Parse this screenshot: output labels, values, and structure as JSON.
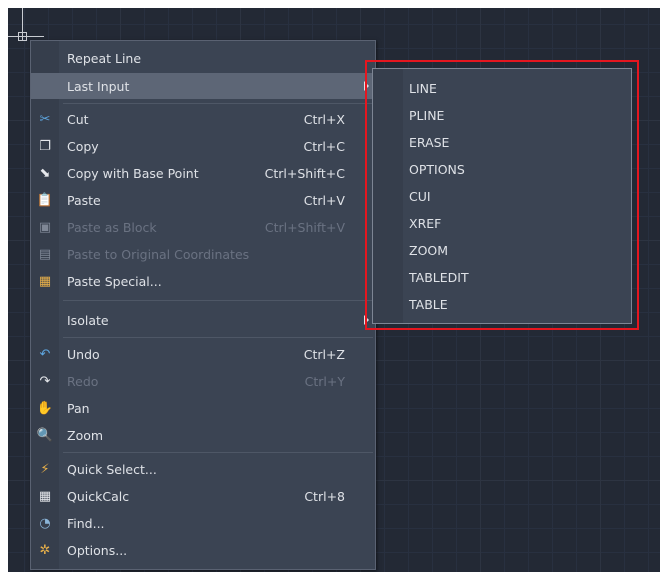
{
  "context_menu": {
    "items": [
      {
        "label": "Repeat Line",
        "shortcut": "",
        "icon": "",
        "disabled": false
      },
      {
        "label": "Last Input",
        "shortcut": "",
        "icon": "",
        "disabled": false,
        "submenu": true,
        "highlighted": true
      },
      {
        "label": "Cut",
        "shortcut": "Ctrl+X",
        "icon": "scissors-icon",
        "disabled": false
      },
      {
        "label": "Copy",
        "shortcut": "Ctrl+C",
        "icon": "copy-icon",
        "disabled": false
      },
      {
        "label": "Copy with Base Point",
        "shortcut": "Ctrl+Shift+C",
        "icon": "copy-base-point-icon",
        "disabled": false
      },
      {
        "label": "Paste",
        "shortcut": "Ctrl+V",
        "icon": "paste-icon",
        "disabled": false
      },
      {
        "label": "Paste as Block",
        "shortcut": "Ctrl+Shift+V",
        "icon": "paste-block-icon",
        "disabled": true
      },
      {
        "label": "Paste to Original Coordinates",
        "shortcut": "",
        "icon": "paste-original-icon",
        "disabled": true
      },
      {
        "label": "Paste Special...",
        "shortcut": "",
        "icon": "paste-special-icon",
        "disabled": false
      },
      {
        "label": "Isolate",
        "shortcut": "",
        "icon": "",
        "disabled": false,
        "submenu": true
      },
      {
        "label": "Undo",
        "shortcut": "Ctrl+Z",
        "icon": "undo-icon",
        "disabled": false
      },
      {
        "label": "Redo",
        "shortcut": "Ctrl+Y",
        "icon": "redo-icon",
        "disabled": true
      },
      {
        "label": "Pan",
        "shortcut": "",
        "icon": "pan-hand-icon",
        "disabled": false
      },
      {
        "label": "Zoom",
        "shortcut": "",
        "icon": "zoom-icon",
        "disabled": false
      },
      {
        "label": "Quick Select...",
        "shortcut": "",
        "icon": "quick-select-icon",
        "disabled": false
      },
      {
        "label": "QuickCalc",
        "shortcut": "Ctrl+8",
        "icon": "calculator-icon",
        "disabled": false
      },
      {
        "label": "Find...",
        "shortcut": "",
        "icon": "find-icon",
        "disabled": false
      },
      {
        "label": "Options...",
        "shortcut": "",
        "icon": "options-gear-icon",
        "disabled": false
      }
    ]
  },
  "last_input_submenu": {
    "items": [
      "LINE",
      "PLINE",
      "ERASE",
      "OPTIONS",
      "CUI",
      "XREF",
      "ZOOM",
      "TABLEDIT",
      "TABLE"
    ]
  },
  "colors": {
    "highlight_box": "#e5161f",
    "menu_bg": "#3b4453",
    "canvas_bg": "#232935"
  }
}
